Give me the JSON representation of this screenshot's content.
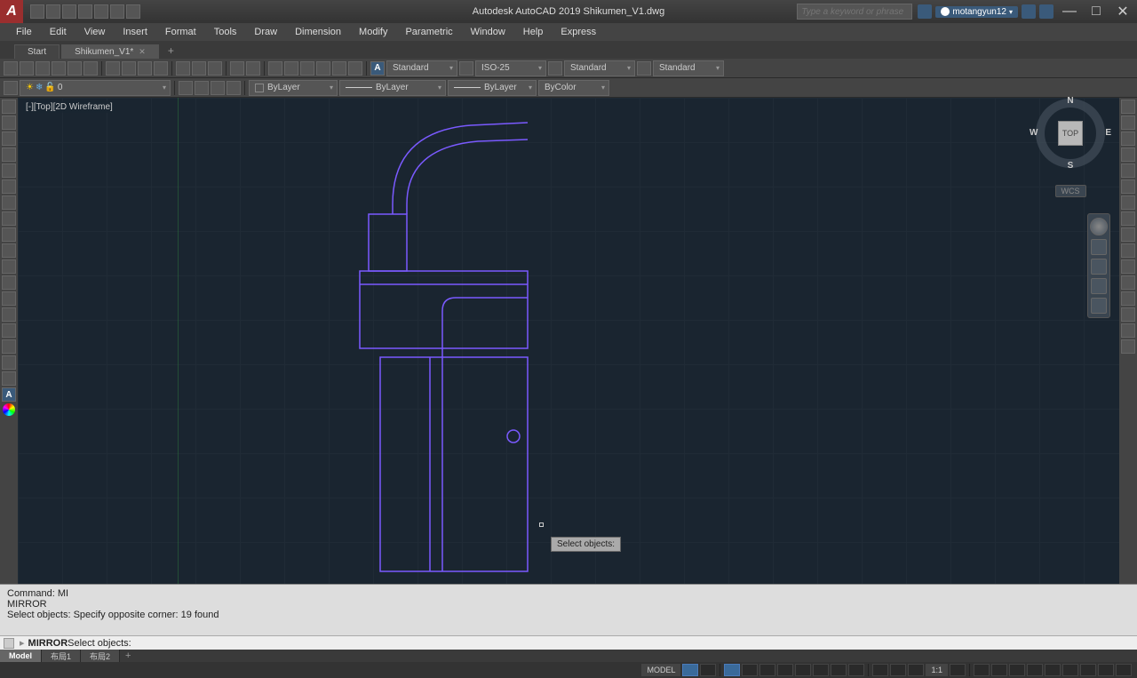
{
  "app": {
    "title": "Autodesk AutoCAD 2019   Shikumen_V1.dwg",
    "logo": "A"
  },
  "search": {
    "placeholder": "Type a keyword or phrase"
  },
  "user": {
    "name": "motangyun12"
  },
  "menu": [
    "File",
    "Edit",
    "View",
    "Insert",
    "Format",
    "Tools",
    "Draw",
    "Dimension",
    "Modify",
    "Parametric",
    "Window",
    "Help",
    "Express"
  ],
  "tabs": {
    "start": "Start",
    "active": "Shikumen_V1*"
  },
  "layer": {
    "current": "0"
  },
  "props": {
    "color_label": "ByLayer",
    "linetype_label": "ByLayer",
    "lineweight_label": "ByLayer",
    "plotstyle_label": "ByColor"
  },
  "styles": {
    "text": "Standard",
    "dim": "ISO-25",
    "table": "Standard",
    "mleader": "Standard"
  },
  "viewport": {
    "label": "[-][Top][2D Wireframe]"
  },
  "viewcube": {
    "face": "TOP",
    "n": "N",
    "s": "S",
    "e": "E",
    "w": "W",
    "wcs": "WCS"
  },
  "tooltip": {
    "text": "Select objects:"
  },
  "cmd": {
    "line1": "Command: MI",
    "line2": "MIRROR",
    "line3": "Select objects: Specify opposite corner: 19 found",
    "prompt_cmd": "MIRROR",
    "prompt_rest": " Select objects:"
  },
  "layout_tabs": {
    "model": "Model",
    "l1": "布局1",
    "l2": "布局2"
  },
  "status": {
    "model_btn": "MODEL",
    "scale": "1:1"
  }
}
